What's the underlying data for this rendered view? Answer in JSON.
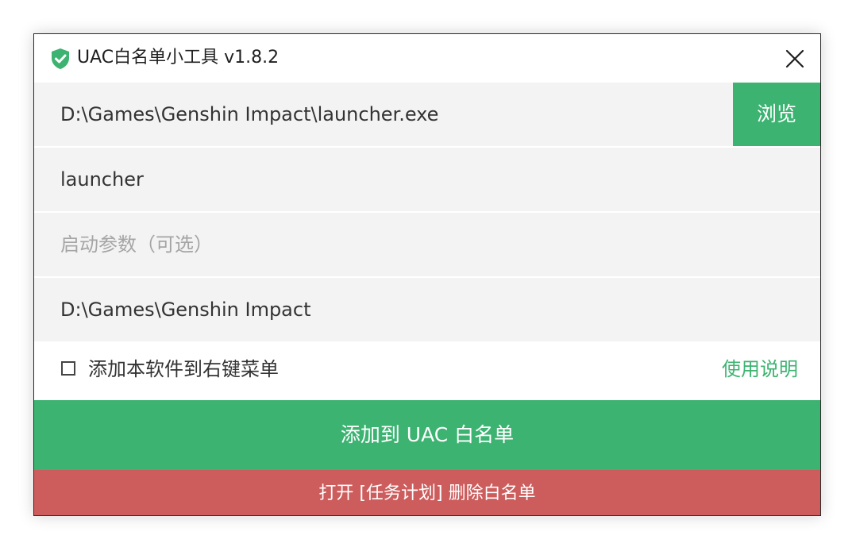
{
  "window": {
    "title": "UAC白名单小工具 v1.8.2",
    "title_icon": "shield-check-icon",
    "close_icon": "close-icon"
  },
  "fields": {
    "program_path": {
      "value": "D:\\Games\\Genshin Impact\\launcher.exe"
    },
    "task_name": {
      "value": "launcher"
    },
    "launch_args": {
      "value": "",
      "placeholder": "启动参数（可选）"
    },
    "working_dir": {
      "value": "D:\\Games\\Genshin Impact"
    }
  },
  "browse_button": {
    "label": "浏览"
  },
  "options": {
    "context_menu_label": "添加本软件到右键菜单",
    "context_menu_checked": false,
    "help_link": "使用说明"
  },
  "buttons": {
    "add_label": "添加到 UAC 白名单",
    "remove_label": "打开 [任务计划] 删除白名单"
  },
  "colors": {
    "accent_green": "#3cb371",
    "danger_red": "#cd5c5c",
    "field_bg": "#f3f3f3"
  }
}
